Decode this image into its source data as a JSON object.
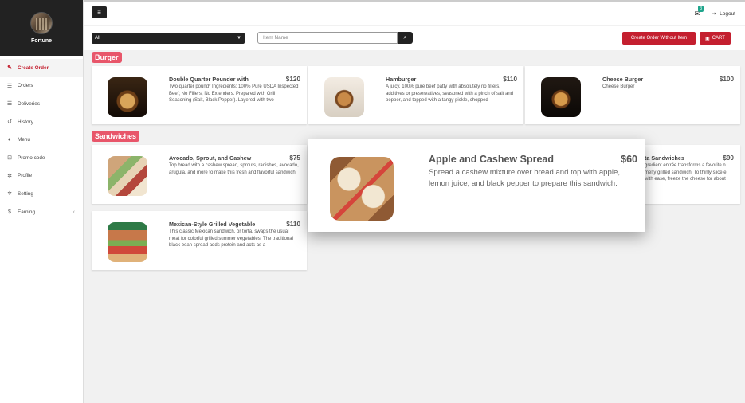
{
  "brand": {
    "name": "Fortune"
  },
  "sidebar": {
    "items": [
      {
        "label": "Create Order",
        "icon": "edit-icon",
        "glyph": "✎"
      },
      {
        "label": "Orders",
        "icon": "list-icon",
        "glyph": "☰"
      },
      {
        "label": "Deliveries",
        "icon": "list-icon",
        "glyph": "☰"
      },
      {
        "label": "History",
        "icon": "history-icon",
        "glyph": "↺"
      },
      {
        "label": "Menu",
        "icon": "globe-icon",
        "glyph": "◐"
      },
      {
        "label": "Promo code",
        "icon": "cart-icon",
        "glyph": "⊡"
      },
      {
        "label": "Profile",
        "icon": "gear-icon",
        "glyph": "✲"
      },
      {
        "label": "Setting",
        "icon": "gear-icon",
        "glyph": "✲"
      },
      {
        "label": "Earning",
        "icon": "dollar-icon",
        "glyph": "$"
      }
    ],
    "earning_chevron": "‹"
  },
  "header": {
    "menu_glyph": "≡",
    "mail_badge": "3",
    "logout_label": "Logout"
  },
  "filters": {
    "category_selected": "All",
    "search_placeholder": "Item Name",
    "create_order_label": "Create Order Without Item",
    "cart_label": "CART"
  },
  "sections": [
    {
      "label": "Burger"
    },
    {
      "label": "Sandwiches"
    }
  ],
  "items": {
    "quarter": {
      "name": "Double Quarter Pounder with",
      "price": "$120",
      "desc": "Two quarter pound* Ingredients: 100% Pure USDA Inspected Beef; No Fillers, No Extenders. Prepared with Grill Seasoning (Salt, Black Pepper). Layered with two"
    },
    "hamburger": {
      "name": "Hamburger",
      "price": "$110",
      "desc": "A juicy, 100% pure beef patty with absolutely no fillers, additives or preservatives, seasoned with a pinch of salt and pepper, and topped with a tangy pickle, chopped"
    },
    "cheese": {
      "name": "Cheese Burger",
      "price": "$100",
      "desc": "Cheese Burger"
    },
    "avocado": {
      "name": "Avocado, Sprout, and Cashew",
      "price": "$75",
      "desc": "Top bread with a cashew spread, sprouts, radishes, avocado, arugula, and more to make this fresh and flavorful sandwich."
    },
    "partial": {
      "name": "ta Sandwiches",
      "price": "$90",
      "desc": "gredient entrée transforms a favorite n melty grilled sandwich. To thinly slice e with ease, freeze the cheese for about 30"
    },
    "mexican": {
      "name": "Mexican-Style Grilled Vegetable",
      "price": "$110",
      "desc": "This classic Mexican sandwich, or torta, swaps the usual meat for colorful grilled summer vegetables. The traditional black bean spread adds protein and acts as a"
    }
  },
  "popup": {
    "name": "Apple and Cashew Spread",
    "price": "$60",
    "desc": "Spread a cashew mixture over bread and top with apple, lemon juice, and black pepper to prepare this sandwich."
  }
}
